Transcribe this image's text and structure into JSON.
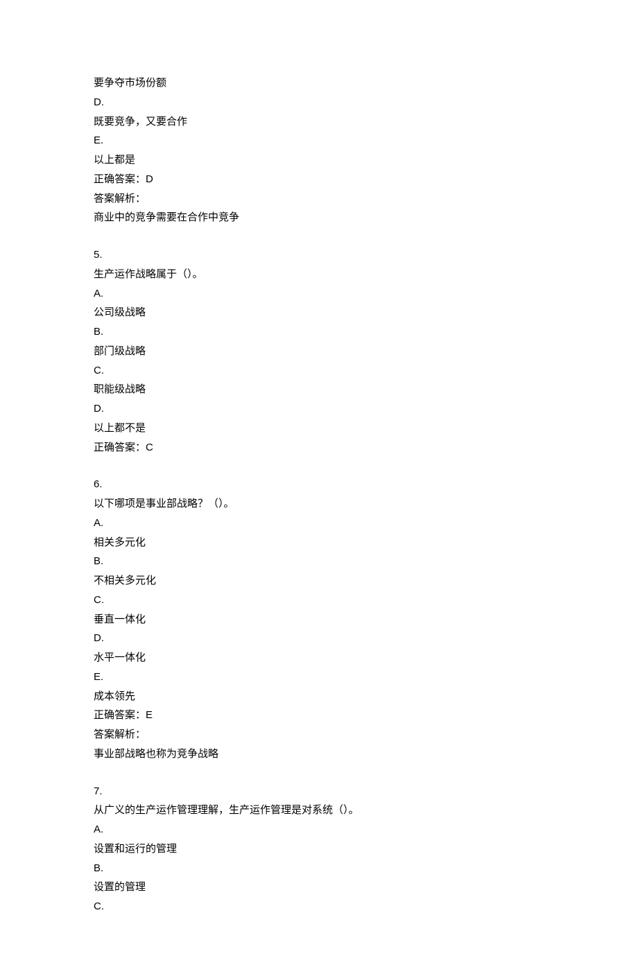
{
  "q4_tail": {
    "c_text": "要争夺市场份额",
    "d_label": "D.",
    "d_text": "既要竞争，又要合作",
    "e_label": "E.",
    "e_text": "以上都是",
    "answer_line": "正确答案：D",
    "explain_label": "答案解析：",
    "explain_text": "商业中的竞争需要在合作中竞争"
  },
  "q5": {
    "num": "5.",
    "stem": "生产运作战略属于（）。",
    "a_label": "A.",
    "a_text": "公司级战略",
    "b_label": "B.",
    "b_text": "部门级战略",
    "c_label": "C.",
    "c_text": "职能级战略",
    "d_label": "D.",
    "d_text": "以上都不是",
    "answer_line": "正确答案：C"
  },
  "q6": {
    "num": "6.",
    "stem": "以下哪项是事业部战略？（）。",
    "a_label": "A.",
    "a_text": "相关多元化",
    "b_label": "B.",
    "b_text": "不相关多元化",
    "c_label": "C.",
    "c_text": "垂直一体化",
    "d_label": "D.",
    "d_text": "水平一体化",
    "e_label": "E.",
    "e_text": "成本领先",
    "answer_line": "正确答案：E",
    "explain_label": "答案解析：",
    "explain_text": "事业部战略也称为竞争战略"
  },
  "q7": {
    "num": "7.",
    "stem": "从广义的生产运作管理理解，生产运作管理是对系统（）。",
    "a_label": "A.",
    "a_text": "设置和运行的管理",
    "b_label": "B.",
    "b_text": "设置的管理",
    "c_label": "C."
  }
}
